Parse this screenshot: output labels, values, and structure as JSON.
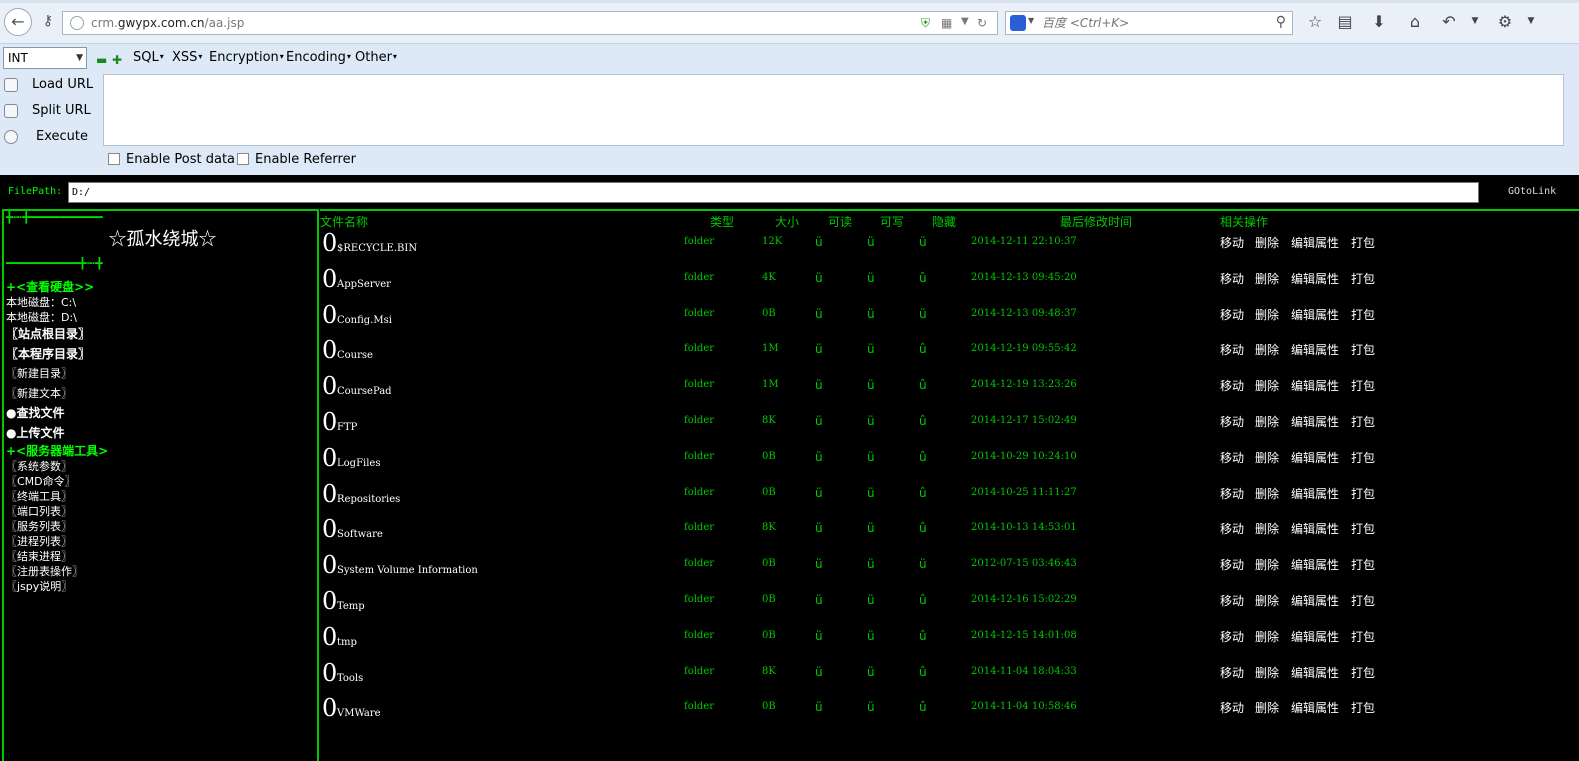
{
  "browser": {
    "url_prefix": "crm.",
    "url_domain": "gwypx.com.cn",
    "url_path": "/aa.jsp",
    "search_placeholder": "百度 <Ctrl+K>"
  },
  "hackbar": {
    "select_value": "INT",
    "menus": [
      "SQL",
      "XSS",
      "Encryption",
      "Encoding",
      "Other"
    ],
    "load_url": "Load URL",
    "split_url": "Split URL",
    "execute": "Execute",
    "enable_post": "Enable Post data",
    "enable_referrer": "Enable Referrer"
  },
  "page": {
    "filepath_label": "FilePath:",
    "filepath_value": "D:/",
    "goto_link": "GOtoLink",
    "left": {
      "deco_top": "╋┅┅╋━━━━━━━━━━━━━",
      "title": "☆孤水绕城☆",
      "deco_bottom": "━━━━━━━━━━━━━╋┅┅╋",
      "view_disks": "+<查看硬盘>>",
      "disk_c": "本地磁盘：C:\\",
      "disk_d": "本地磁盘：D:\\",
      "site_root": "〖站点根目录〗",
      "program_dir": "〖本程序目录〗",
      "new_dir": "〖新建目录〗",
      "new_text": "〖新建文本〗",
      "find_file": "●查找文件",
      "upload_file": "●上传文件",
      "server_tools": "+<服务器端工具>",
      "tools": [
        "〖系统参数〗",
        "〖CMD命令〗",
        "〖终端工具〗",
        "〖端口列表〗",
        "〖服务列表〗",
        "〖进程列表〗",
        "〖结束进程〗",
        "〖注册表操作〗",
        "〖jspy说明〗"
      ]
    },
    "table": {
      "headers": {
        "name": "文件名称",
        "type": "类型",
        "size": "大小",
        "readable": "可读",
        "writable": "可写",
        "hidden": "隐藏",
        "modified": "最后修改时间",
        "actions": "相关操作"
      },
      "icon_glyph": "0",
      "ops": [
        "移动",
        "删除",
        "编辑属性",
        "打包"
      ],
      "rows": [
        {
          "name": "$RECYCLE.BIN",
          "type": "folder",
          "size": "12K",
          "r": "ü",
          "w": "ü",
          "h": "ü",
          "time": "2014-12-11 22:10:37"
        },
        {
          "name": "AppServer",
          "type": "folder",
          "size": "4K",
          "r": "ü",
          "w": "ü",
          "h": "û",
          "time": "2014-12-13 09:45:20"
        },
        {
          "name": "Config.Msi",
          "type": "folder",
          "size": "0B",
          "r": "ü",
          "w": "ü",
          "h": "ü",
          "time": "2014-12-13 09:48:37"
        },
        {
          "name": "Course",
          "type": "folder",
          "size": "1M",
          "r": "ü",
          "w": "ü",
          "h": "û",
          "time": "2014-12-19 09:55:42"
        },
        {
          "name": "CoursePad",
          "type": "folder",
          "size": "1M",
          "r": "ü",
          "w": "ü",
          "h": "û",
          "time": "2014-12-19 13:23:26"
        },
        {
          "name": "FTP",
          "type": "folder",
          "size": "8K",
          "r": "ü",
          "w": "ü",
          "h": "û",
          "time": "2014-12-17 15:02:49"
        },
        {
          "name": "LogFiles",
          "type": "folder",
          "size": "0B",
          "r": "ü",
          "w": "ü",
          "h": "û",
          "time": "2014-10-29 10:24:10"
        },
        {
          "name": "Repositories",
          "type": "folder",
          "size": "0B",
          "r": "ü",
          "w": "ü",
          "h": "û",
          "time": "2014-10-25 11:11:27"
        },
        {
          "name": "Software",
          "type": "folder",
          "size": "8K",
          "r": "ü",
          "w": "ü",
          "h": "û",
          "time": "2014-10-13 14:53:01"
        },
        {
          "name": "System Volume Information",
          "type": "folder",
          "size": "0B",
          "r": "ü",
          "w": "ü",
          "h": "ü",
          "time": "2012-07-15 03:46:43"
        },
        {
          "name": "Temp",
          "type": "folder",
          "size": "0B",
          "r": "ü",
          "w": "ü",
          "h": "û",
          "time": "2014-12-16 15:02:29"
        },
        {
          "name": "tmp",
          "type": "folder",
          "size": "0B",
          "r": "ü",
          "w": "ü",
          "h": "û",
          "time": "2014-12-15 14:01:08"
        },
        {
          "name": "Tools",
          "type": "folder",
          "size": "8K",
          "r": "ü",
          "w": "ü",
          "h": "û",
          "time": "2014-11-04 18:04:33"
        },
        {
          "name": "VMWare",
          "type": "folder",
          "size": "0B",
          "r": "ü",
          "w": "ü",
          "h": "û",
          "time": "2014-11-04 10:58:46"
        }
      ]
    }
  }
}
